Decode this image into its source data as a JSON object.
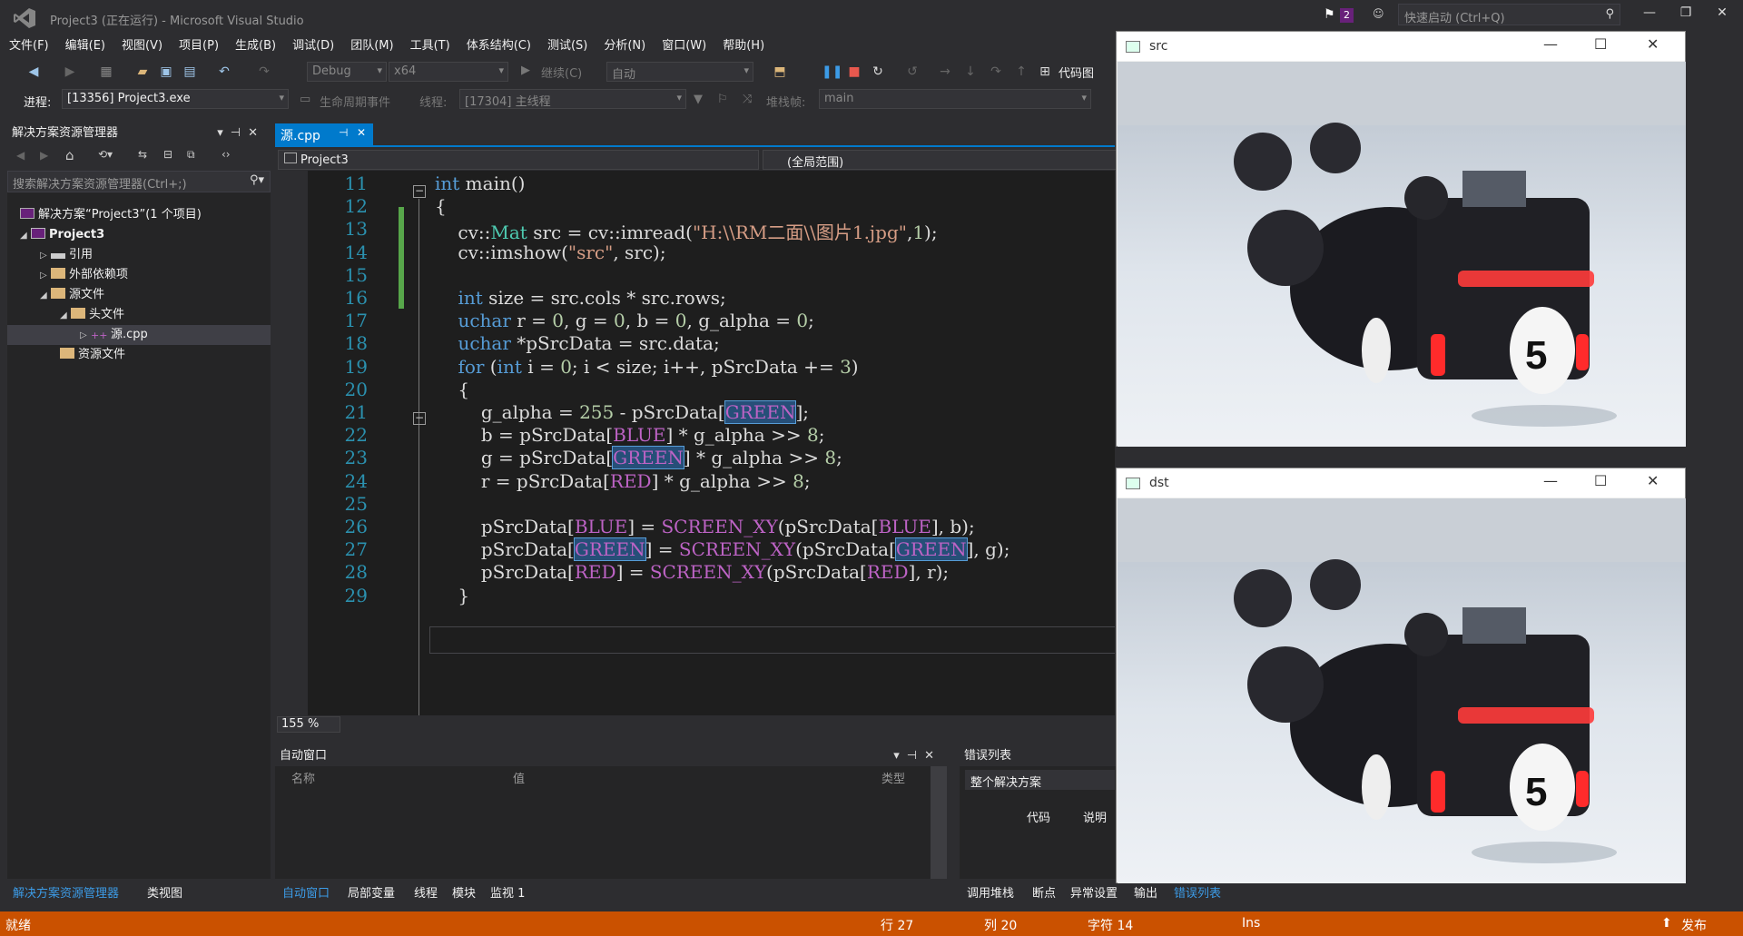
{
  "window": {
    "title": "Project3 (正在运行) - Microsoft Visual Studio",
    "notifications": "2",
    "quick_launch_placeholder": "快速启动 (Ctrl+Q)"
  },
  "menu": [
    "文件(F)",
    "编辑(E)",
    "视图(V)",
    "项目(P)",
    "生成(B)",
    "调试(D)",
    "团队(M)",
    "工具(T)",
    "体系结构(C)",
    "测试(S)",
    "分析(N)",
    "窗口(W)",
    "帮助(H)"
  ],
  "toolbar": {
    "config": "Debug",
    "platform": "x64",
    "continue": "继续(C)",
    "auto": "自动",
    "code_map": "代码图"
  },
  "debugbar": {
    "process_label": "进程:",
    "process": "[13356] Project3.exe",
    "lifecycle": "生命周期事件",
    "thread_label": "线程:",
    "thread": "[17304] 主线程",
    "stack_label": "堆栈帧:",
    "stack": "main"
  },
  "solution_explorer": {
    "title": "解决方案资源管理器",
    "search_placeholder": "搜索解决方案资源管理器(Ctrl+;)",
    "items": [
      {
        "label": "解决方案“Project3”(1 个项目)"
      },
      {
        "label": "Project3"
      },
      {
        "label": "引用"
      },
      {
        "label": "外部依赖项"
      },
      {
        "label": "源文件"
      },
      {
        "label": "头文件"
      },
      {
        "label": "源.cpp"
      },
      {
        "label": "资源文件"
      }
    ],
    "tabs": [
      "解决方案资源管理器",
      "类视图"
    ]
  },
  "editor": {
    "tab": "源.cpp",
    "project_scope": "Project3",
    "global_scope": "(全局范围)",
    "zoom": "155 %",
    "line_numbers": [
      "11",
      "12",
      "13",
      "14",
      "15",
      "16",
      "17",
      "18",
      "19",
      "20",
      "21",
      "22",
      "23",
      "24",
      "25",
      "26",
      "27",
      "28",
      "29"
    ],
    "code_lines": [
      "int main()",
      "{",
      "    cv::Mat src = cv::imread(\"H:\\\\RM二面\\\\图片1.jpg\",1);",
      "    cv::imshow(\"src\", src);",
      "",
      "    int size = src.cols * src.rows;",
      "    uchar r = 0, g = 0, b = 0, g_alpha = 0;",
      "    uchar *pSrcData = src.data;",
      "    for (int i = 0; i < size; i++, pSrcData += 3)",
      "    {",
      "        g_alpha = 255 - pSrcData[GREEN];",
      "        b = pSrcData[BLUE] * g_alpha >> 8;",
      "        g = pSrcData[GREEN] * g_alpha >> 8;",
      "        r = pSrcData[RED] * g_alpha >> 8;",
      "",
      "        pSrcData[BLUE] = SCREEN_XY(pSrcData[BLUE], b);",
      "        pSrcData[GREEN] = SCREEN_XY(pSrcData[GREEN], g);",
      "        pSrcData[RED] = SCREEN_XY(pSrcData[RED], r);",
      "    }"
    ]
  },
  "auto_window": {
    "title": "自动窗口",
    "columns": [
      "名称",
      "值",
      "类型"
    ],
    "tabs": [
      "自动窗口",
      "局部变量",
      "线程",
      "模块",
      "监视 1"
    ]
  },
  "error_list": {
    "title": "错误列表",
    "scope": "整个解决方案",
    "columns": [
      "代码",
      "说明"
    ],
    "tabs": [
      "调用堆栈",
      "断点",
      "异常设置",
      "输出",
      "错误列表"
    ]
  },
  "image_windows": {
    "src_title": "src",
    "dst_title": "dst"
  },
  "statusbar": {
    "ready": "就绪",
    "line": "行 27",
    "col": "列 20",
    "char": "字符 14",
    "ins": "Ins",
    "publish": "发布"
  },
  "colors": {
    "accent": "#007acc",
    "status": "#ca5100",
    "keyword": "#569cd6",
    "macro": "#bd63c5"
  }
}
